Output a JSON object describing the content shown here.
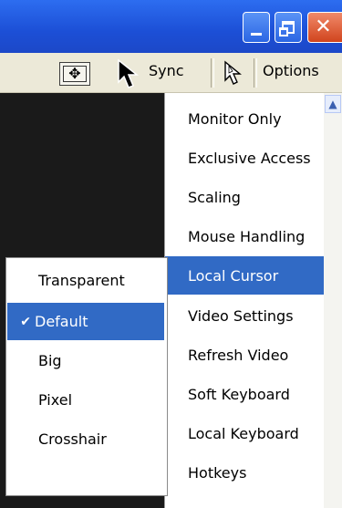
{
  "window": {
    "minimize_glyph": "",
    "maximize_glyph": "",
    "close_glyph": "✕"
  },
  "toolbar": {
    "sync_label": "Sync",
    "options_label": "Options"
  },
  "menu": {
    "items": [
      {
        "label": "Monitor Only"
      },
      {
        "label": "Exclusive Access"
      },
      {
        "label": "Scaling"
      },
      {
        "label": "Mouse Handling"
      },
      {
        "label": "Local Cursor",
        "selected": true
      },
      {
        "label": "Video Settings"
      },
      {
        "label": "Refresh Video"
      },
      {
        "label": "Soft Keyboard"
      },
      {
        "label": "Local Keyboard"
      },
      {
        "label": "Hotkeys"
      }
    ]
  },
  "submenu": {
    "items": [
      {
        "label": "Transparent"
      },
      {
        "label": "Default",
        "checked": true,
        "selected": true
      },
      {
        "label": "Big"
      },
      {
        "label": "Pixel"
      },
      {
        "label": "Crosshair"
      }
    ],
    "check_glyph": "✔"
  },
  "colors": {
    "selection": "#316ac5",
    "titlebar": "#2d6df0",
    "viewport": "#1a1a1a"
  }
}
